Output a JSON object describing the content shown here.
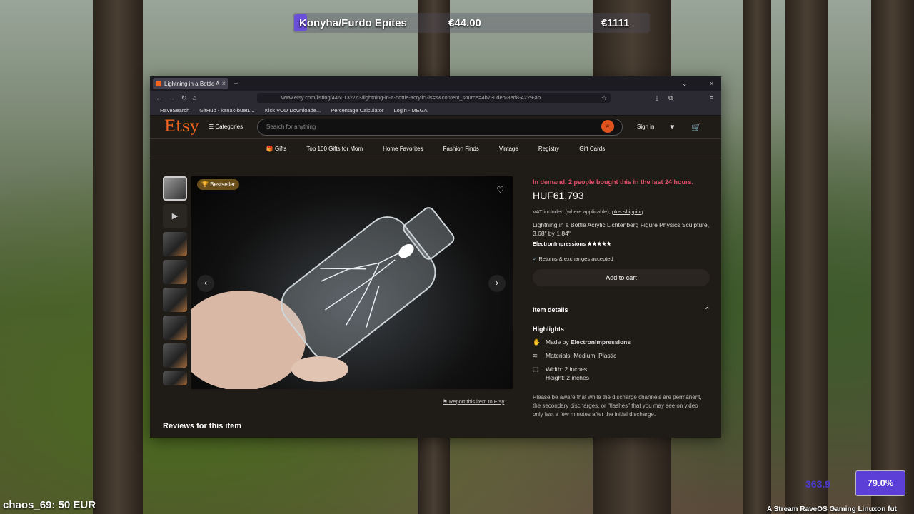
{
  "overlay": {
    "item": "Konyha/Furdo Epites",
    "price": "€44.00",
    "total": "€1111",
    "donation": "chaos_69: 50 EUR",
    "progress_text": "79.0%",
    "ghost_value": "363.9",
    "ticker": "A Stream RaveOS Gaming Linuxon fut"
  },
  "browser": {
    "tab_title": "Lightning in a Bottle Acr",
    "url": "www.etsy.com/listing/4460132763/lightning-in-a-bottle-acrylic?ls=s&content_source=4b730deb-8ed8-4229-ab",
    "bookmarks": [
      "RaveSearch",
      "GitHub - kanak-buet1...",
      "Kick VOD Downloade...",
      "Percentage Calculator",
      "Login - MEGA"
    ]
  },
  "etsy": {
    "logo": "Etsy",
    "categories": "Categories",
    "search_placeholder": "Search for anything",
    "signin": "Sign in",
    "nav": [
      "Gifts",
      "Top 100 Gifts for Mom",
      "Home Favorites",
      "Fashion Finds",
      "Vintage",
      "Registry",
      "Gift Cards"
    ],
    "badge": "Bestseller",
    "report": "Report this item to Etsy",
    "reviews_title": "Reviews for this item",
    "demand": "In demand. 2 people bought this in the last 24 hours.",
    "price": "HUF61,793",
    "vat": "VAT included (where applicable),",
    "shipping": "plus shipping",
    "product_title": "Lightning in a Bottle Acrylic Lichtenberg Figure Physics Sculpture, 3.68\" by 1.84\"",
    "shop": "ElectronImpressions",
    "stars": "★★★★★",
    "returns": "Returns & exchanges accepted",
    "add_to_cart": "Add to cart",
    "item_details": "Item details",
    "highlights": "Highlights",
    "made_by_prefix": "Made by",
    "materials": "Materials: Medium: Plastic",
    "width": "Width: 2 inches",
    "height": "Height: 2 inches",
    "disclaimer": "Please be aware that while the discharge channels are permanent, the secondary discharges, or \"flashes\" that you may see on video only last a few minutes after the initial discharge."
  }
}
